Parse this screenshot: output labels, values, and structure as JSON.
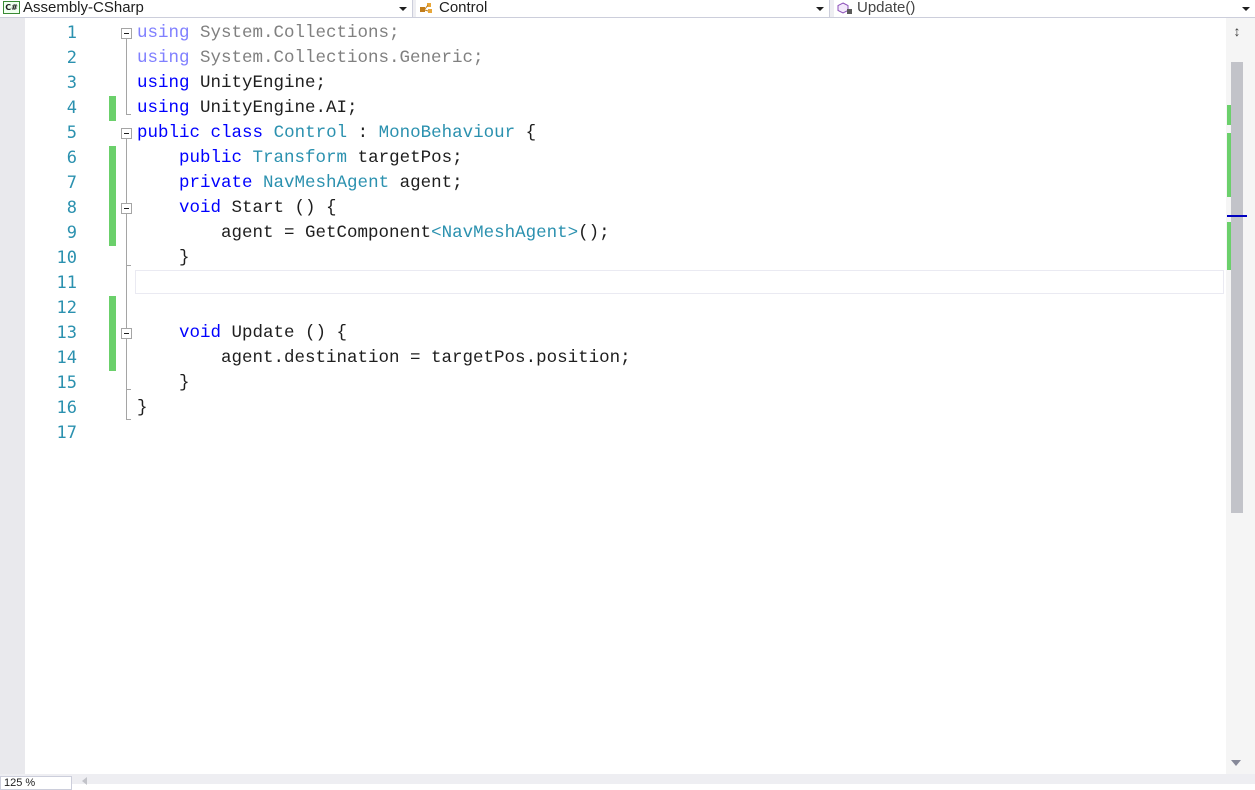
{
  "nav": {
    "project": {
      "label": "Assembly-CSharp",
      "icon": "csharp-project-icon",
      "badge": "C#"
    },
    "type": {
      "label": "Control",
      "icon": "class-icon"
    },
    "member": {
      "label": "Update()",
      "icon": "method-icon"
    }
  },
  "editor": {
    "line_numbers": [
      "1",
      "2",
      "3",
      "4",
      "5",
      "6",
      "7",
      "8",
      "9",
      "10",
      "11",
      "12",
      "13",
      "14",
      "15",
      "16",
      "17"
    ],
    "lines": {
      "l1": {
        "kw": "using",
        "rest": " System.Collections;"
      },
      "l2": {
        "kw": "using",
        "rest": " System.Collections.Generic;"
      },
      "l3": {
        "kw": "using",
        "rest": " UnityEngine;"
      },
      "l4": {
        "kw": "using",
        "rest": " UnityEngine.AI;"
      },
      "l5": {
        "kw1": "public",
        "kw2": "class",
        "name": "Control",
        "sep": " : ",
        "base": "MonoBehaviour",
        "tail": " {"
      },
      "l6": {
        "indent": "    ",
        "kw": "public",
        "type": "Transform",
        "rest": " targetPos;"
      },
      "l7": {
        "indent": "    ",
        "kw": "private",
        "type": "NavMeshAgent",
        "rest": " agent;"
      },
      "l8": {
        "indent": "    ",
        "kw": "void",
        "rest": " Start () {"
      },
      "l9": {
        "indent": "        ",
        "pre": "agent = GetComponent",
        "generic": "<NavMeshAgent>",
        "post": "();"
      },
      "l10": {
        "text": "    }"
      },
      "l13": {
        "indent": "    ",
        "kw": "void",
        "rest": " Update () {"
      },
      "l14": {
        "text": "        agent.destination = targetPos.position;"
      },
      "l15": {
        "text": "    }"
      },
      "l16": {
        "text": "}"
      }
    }
  },
  "status": {
    "zoom": "125 %"
  },
  "colors": {
    "keyword": "#0000ff",
    "type": "#2b91af",
    "line_number": "#2b91af",
    "change_marker": "#6bd06b"
  }
}
